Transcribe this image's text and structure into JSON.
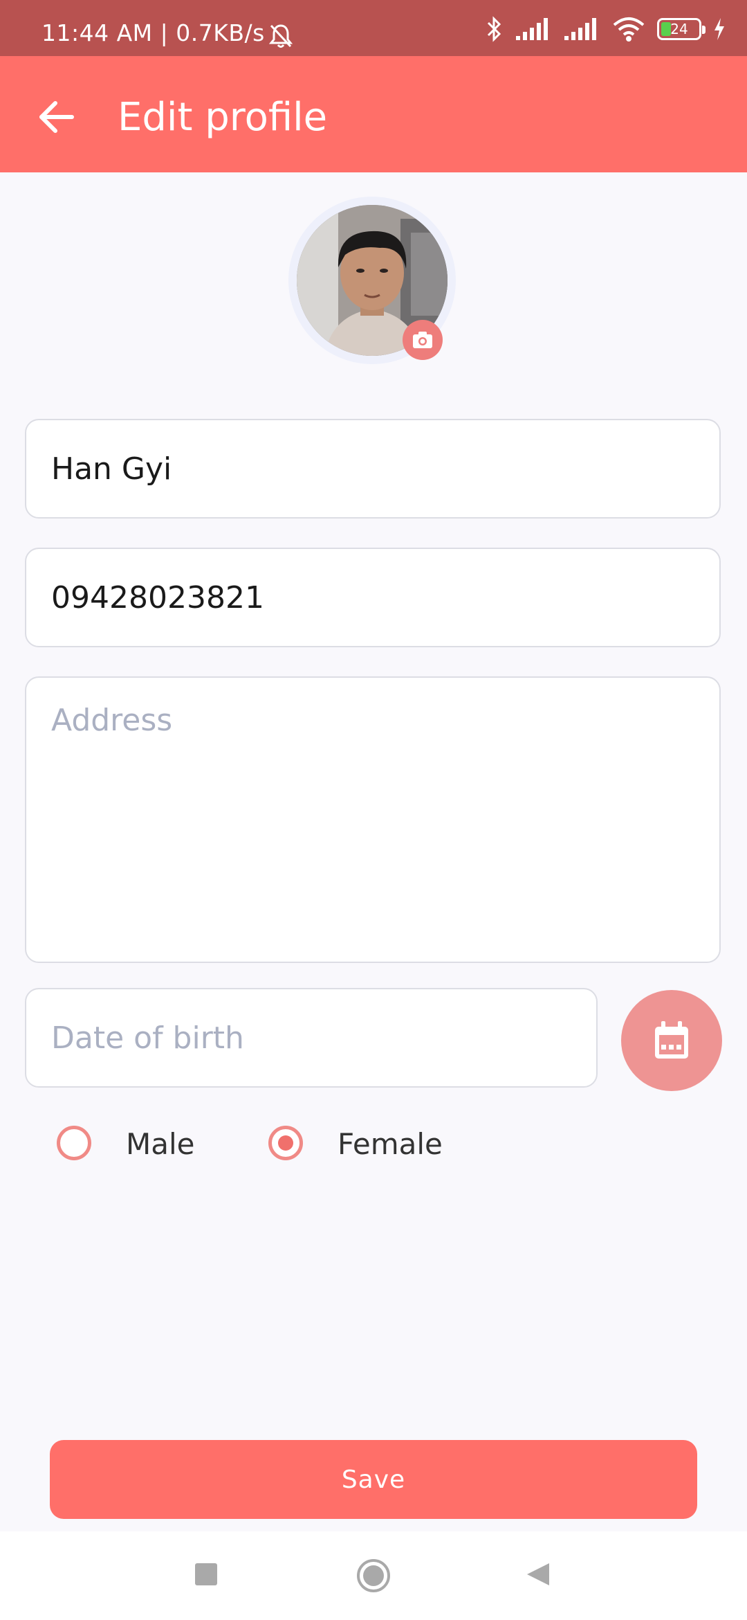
{
  "status_bar": {
    "time": "11:44 AM | 0.7KB/s",
    "battery": "24",
    "icons": [
      "mute-bell-icon",
      "bluetooth-icon",
      "signal-icon",
      "signal-icon",
      "wifi-icon",
      "battery-icon",
      "charging-icon"
    ]
  },
  "app_bar": {
    "title": "Edit profile",
    "back_icon": "arrow-left-icon"
  },
  "profile": {
    "avatar_icon": "profile-photo",
    "camera_icon": "camera-icon"
  },
  "form": {
    "name_value": "Han Gyi",
    "phone_value": "09428023821",
    "address_placeholder": "Address",
    "dob_placeholder": "Date of birth",
    "calendar_icon": "calendar-icon",
    "gender": {
      "options": [
        "Male",
        "Female"
      ],
      "selected": "Female"
    }
  },
  "actions": {
    "save_label": "Save"
  },
  "nav": {
    "icons": [
      "recent-apps-icon",
      "home-icon",
      "back-icon"
    ]
  },
  "colors": {
    "primary": "#ff6f69",
    "status_bar": "#b85250",
    "background": "#f9f8fc"
  }
}
